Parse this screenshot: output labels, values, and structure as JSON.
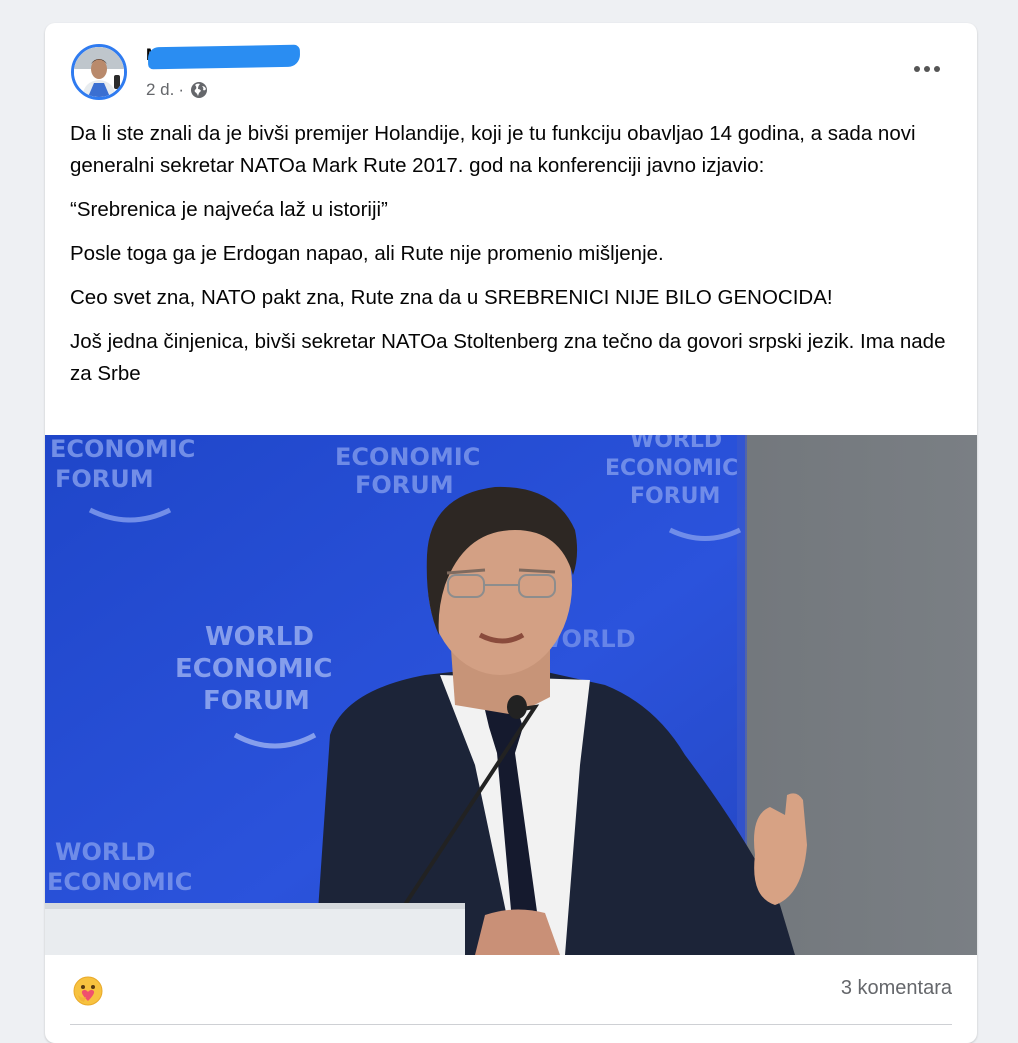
{
  "post": {
    "author_name": "M",
    "time": "2 d.",
    "separator": "·",
    "visibility_icon": "globe-icon",
    "more_icon": "more-options-icon",
    "paragraphs": [
      "Da li ste znali da je bivši premijer Holandije, koji je tu funkciju obavljao 14 godina, a sada novi generalni sekretar NATOa Mark Rute 2017. god na konferenciji javno izjavio:",
      "“Srebrenica je najveća laž u istoriji”",
      "Posle toga ga je Erdogan napao, ali Rute nije promenio mišljenje.",
      "Ceo svet zna, NATO pakt zna, Rute zna da u SREBRENICI NIJE BILO GENOCIDA!",
      "Još jedna činjenica, bivši sekretar NATOa Stoltenberg zna tečno da govori srpski jezik. Ima nade za Srbe"
    ],
    "photo": {
      "backdrop_text_lines": [
        "WORLD",
        "ECONOMIC",
        "FORUM"
      ],
      "backdrop_color": "#2a4fd8",
      "wall_color": "#6f7479"
    },
    "reaction_icon": "care-reaction-icon",
    "comments_label": "3 komentara"
  }
}
